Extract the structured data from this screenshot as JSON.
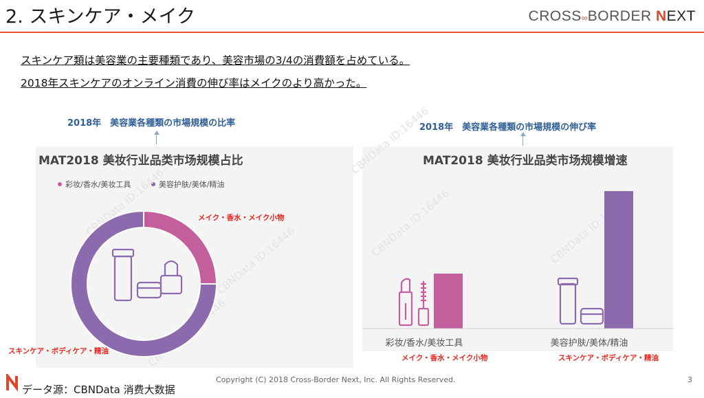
{
  "header": {
    "title": "2. スキンケア・メイク",
    "brand_part1": "CROSS",
    "brand_part2": "BORDER",
    "brand_n": "N",
    "brand_ext": "EXT"
  },
  "bullets": [
    "スキンケア類は美容業の主要種類であり、美容市場の3/4の消費額を占めている。",
    "2018年スキンケアのオンライン消費の伸び率はメイクのより高かった。"
  ],
  "captions": {
    "left": "2018年　美容業各種類の市場規模の比率",
    "right": "2018年　美容業各種類の市場規模の伸び率"
  },
  "watermark": "CBNData ID:16446",
  "colors": {
    "makeup": "#c45f9e",
    "skincare": "#8b6aad",
    "accent": "#e8542f",
    "caption": "#2f5f96",
    "label_red": "#e8261e"
  },
  "chart_data": [
    {
      "type": "pie",
      "title": "MAT2018 美妆行业品类市场规模占比",
      "legend": [
        "彩妆/香水/美妆工具",
        "美容护肤/美体/精油"
      ],
      "categories": [
        "彩妆/香水/美妆工具",
        "美容护肤/美体/精油"
      ],
      "values": [
        25,
        75
      ],
      "annotations": [
        "メイク・香水・メイク小物",
        "スキンケア・ボディケア・精油"
      ]
    },
    {
      "type": "bar",
      "title": "MAT2018 美妆行业品类市场规模增速",
      "categories": [
        "彩妆/香水/美妆工具",
        "美容护肤/美体/精油"
      ],
      "values": [
        1,
        2.5
      ],
      "annotations": [
        "メイク・香水・メイク小物",
        "スキンケア・ボディケア・精油"
      ]
    }
  ],
  "footer": {
    "source": "データ源：CBNData 消费大数据",
    "copyright": "Copyright (C) 2018 Cross-Border Next, Inc. All Rights Reserved.",
    "page": "3"
  }
}
